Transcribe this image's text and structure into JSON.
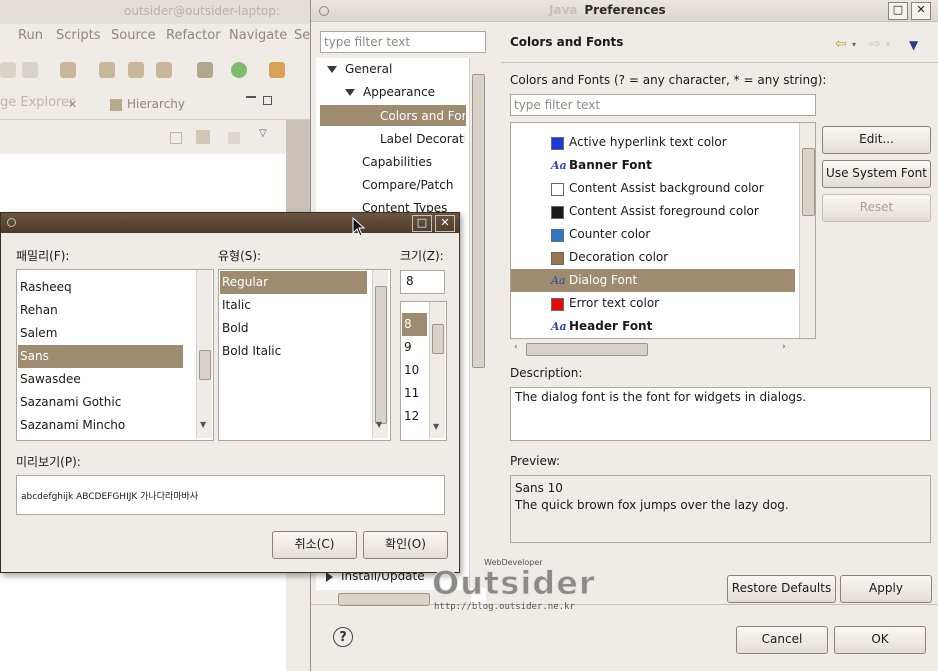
{
  "eclipse": {
    "title": "outsider@outsider-laptop:",
    "menu": [
      "Run",
      "Scripts",
      "Source",
      "Refactor",
      "Navigate",
      "Se"
    ],
    "menu_mnemonic_index": [
      0,
      0,
      0,
      2,
      0,
      0
    ],
    "tab_explorer": "ge Explorer",
    "tab_hierarchy": "Hierarchy"
  },
  "prefs": {
    "window_title": "Preferences",
    "window_title_hidden": "Java",
    "tree_filter_placeholder": "type filter text",
    "tree": [
      {
        "label": "General",
        "arrow": "down",
        "indent": 0
      },
      {
        "label": "Appearance",
        "arrow": "down",
        "indent": 1
      },
      {
        "label": "Colors and Fonts",
        "arrow": "none",
        "indent": 2,
        "selected": true
      },
      {
        "label": "Label Decorations",
        "arrow": "none",
        "indent": 2
      },
      {
        "label": "Capabilities",
        "arrow": "none",
        "indent": 1
      },
      {
        "label": "Compare/Patch",
        "arrow": "none",
        "indent": 1
      },
      {
        "label": "Content Types",
        "arrow": "none",
        "indent": 1
      }
    ],
    "tree_bottom_item": "Install/Update",
    "heading": "Colors and Fonts",
    "cf_label": "Colors and Fonts (? = any character, * = any string):",
    "cf_filter_placeholder": "type filter text",
    "cf_items": [
      {
        "label": "Active hyperlink text color",
        "kind": "color",
        "color": "#1c3ad8"
      },
      {
        "label": "Banner Font",
        "kind": "font",
        "bold": true
      },
      {
        "label": "Content Assist background color",
        "kind": "color",
        "color": "#ffffff"
      },
      {
        "label": "Content Assist foreground color",
        "kind": "color",
        "color": "#1a1a1a"
      },
      {
        "label": "Counter color",
        "kind": "color",
        "color": "#2f78c4"
      },
      {
        "label": "Decoration color",
        "kind": "color",
        "color": "#94774a"
      },
      {
        "label": "Dialog Font",
        "kind": "font",
        "selected": true
      },
      {
        "label": "Error text color",
        "kind": "color",
        "color": "#e50b0b"
      },
      {
        "label": "Header Font",
        "kind": "font",
        "bold": true
      }
    ],
    "btn_edit": "Edit...",
    "btn_use_system_font": "Use System Font",
    "btn_reset": "Reset",
    "description_label": "Description:",
    "description_text": "The dialog font is the font for widgets in dialogs.",
    "preview_label": "Preview:",
    "preview_line1": "Sans 10",
    "preview_line2": "The quick brown fox jumps over the lazy dog.",
    "btn_restore_defaults": "Restore Defaults",
    "btn_apply": "Apply",
    "btn_cancel": "Cancel",
    "btn_ok": "OK",
    "help_symbol": "?"
  },
  "font_dialog": {
    "family_label": "패밀리(F):",
    "style_label": "유형(S):",
    "size_label": "크기(Z):",
    "families": [
      "Rasheeq",
      "Rehan",
      "Salem",
      "Sans",
      "Sawasdee",
      "Sazanami Gothic",
      "Sazanami Mincho"
    ],
    "selected_family": "Sans",
    "styles": [
      "Regular",
      "Italic",
      "Bold",
      "Bold Italic"
    ],
    "selected_style": "Regular",
    "size_value": "8",
    "sizes": [
      "8",
      "9",
      "10",
      "11",
      "12"
    ],
    "selected_size": "8",
    "preview_label": "미리보기(P):",
    "preview_text": "abcdefghijk ABCDEFGHIJK 가나다라마바사",
    "btn_cancel": "취소(C)",
    "btn_ok": "확인(O)"
  },
  "watermark": {
    "brand": "Outsider",
    "tagline": "WebDeveloper",
    "url": "http://blog.outsider.ne.kr"
  },
  "colors": {
    "selection": "#9e8b70",
    "font_dialog_titlebar": "#4d3b2d"
  }
}
